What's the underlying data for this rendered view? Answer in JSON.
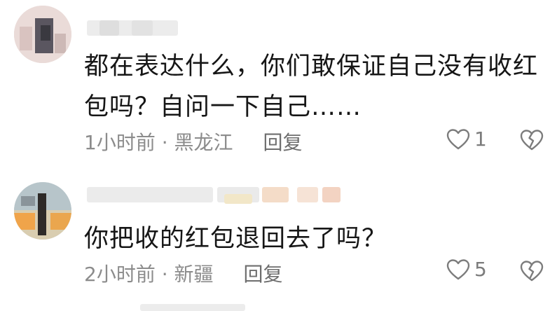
{
  "comments": [
    {
      "text": "都在表达什么，你们敢保证自己没有收红包吗？自问一下自己……",
      "time": "1小时前",
      "separator": "·",
      "location": "黑龙江",
      "reply_label": "回复",
      "likes": "1"
    },
    {
      "text": "你把收的红包退回去了吗？",
      "time": "2小时前",
      "separator": "·",
      "location": "新疆",
      "reply_label": "回复",
      "likes": "5"
    }
  ],
  "icons": {
    "like": "heart-outline-icon",
    "dislike": "broken-heart-icon"
  },
  "colors": {
    "text": "#161616",
    "meta": "#8c8c8c",
    "icon": "#7c7c7c"
  }
}
